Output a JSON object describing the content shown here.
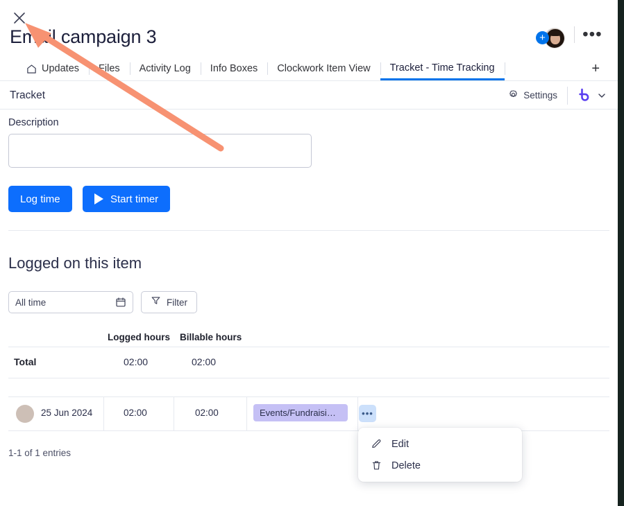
{
  "window": {
    "close_icon": "close-x-icon"
  },
  "header": {
    "title": "Email campaign 3",
    "add_person_label": "+",
    "more_label": "•••",
    "avatar_name": "user-avatar"
  },
  "tabs": [
    {
      "label": "Updates",
      "icon": "home-icon",
      "active": false
    },
    {
      "label": "Files",
      "icon": "",
      "active": false
    },
    {
      "label": "Activity Log",
      "icon": "",
      "active": false
    },
    {
      "label": "Info Boxes",
      "icon": "",
      "active": false
    },
    {
      "label": "Clockwork Item View",
      "icon": "",
      "active": false
    },
    {
      "label": "Tracket - Time Tracking",
      "icon": "",
      "active": true
    }
  ],
  "tab_add_label": "+",
  "app_header": {
    "app_name": "Tracket",
    "settings_label": "Settings",
    "settings_icon": "gear-icon",
    "brand_icon": "tracket-logo-icon",
    "chevron_icon": "chevron-down-icon"
  },
  "form": {
    "description_label": "Description",
    "description_value": "",
    "description_placeholder": "",
    "log_time_label": "Log time",
    "start_timer_label": "Start timer",
    "play_icon": "play-icon"
  },
  "logged_section": {
    "title": "Logged on this item",
    "date_filter_value": "All time",
    "calendar_icon": "calendar-icon",
    "filter_label": "Filter",
    "filter_icon": "funnel-icon"
  },
  "table": {
    "columns": [
      "",
      "Logged hours",
      "Billable hours",
      "",
      ""
    ],
    "total_row": {
      "label": "Total",
      "logged_hours": "02:00",
      "billable_hours": "02:00"
    },
    "rows": [
      {
        "avatar": "row-user-avatar",
        "date": "25 Jun 2024",
        "logged_hours": "02:00",
        "billable_hours": "02:00",
        "tag": "Events/Fundraisi…",
        "kebab_label": "•••"
      }
    ],
    "entries_summary": "1-1 of 1 entries"
  },
  "context_menu": {
    "items": [
      {
        "label": "Edit",
        "icon": "pencil-icon"
      },
      {
        "label": "Delete",
        "icon": "trash-icon"
      }
    ]
  },
  "colors": {
    "accent_blue": "#0073ea",
    "button_blue": "#0d6efd",
    "tag_purple": "#c5c0f5",
    "kebab_blue": "#cce0fb",
    "brand_purple": "#5a3ef0",
    "annotation_orange": "#f79272"
  }
}
